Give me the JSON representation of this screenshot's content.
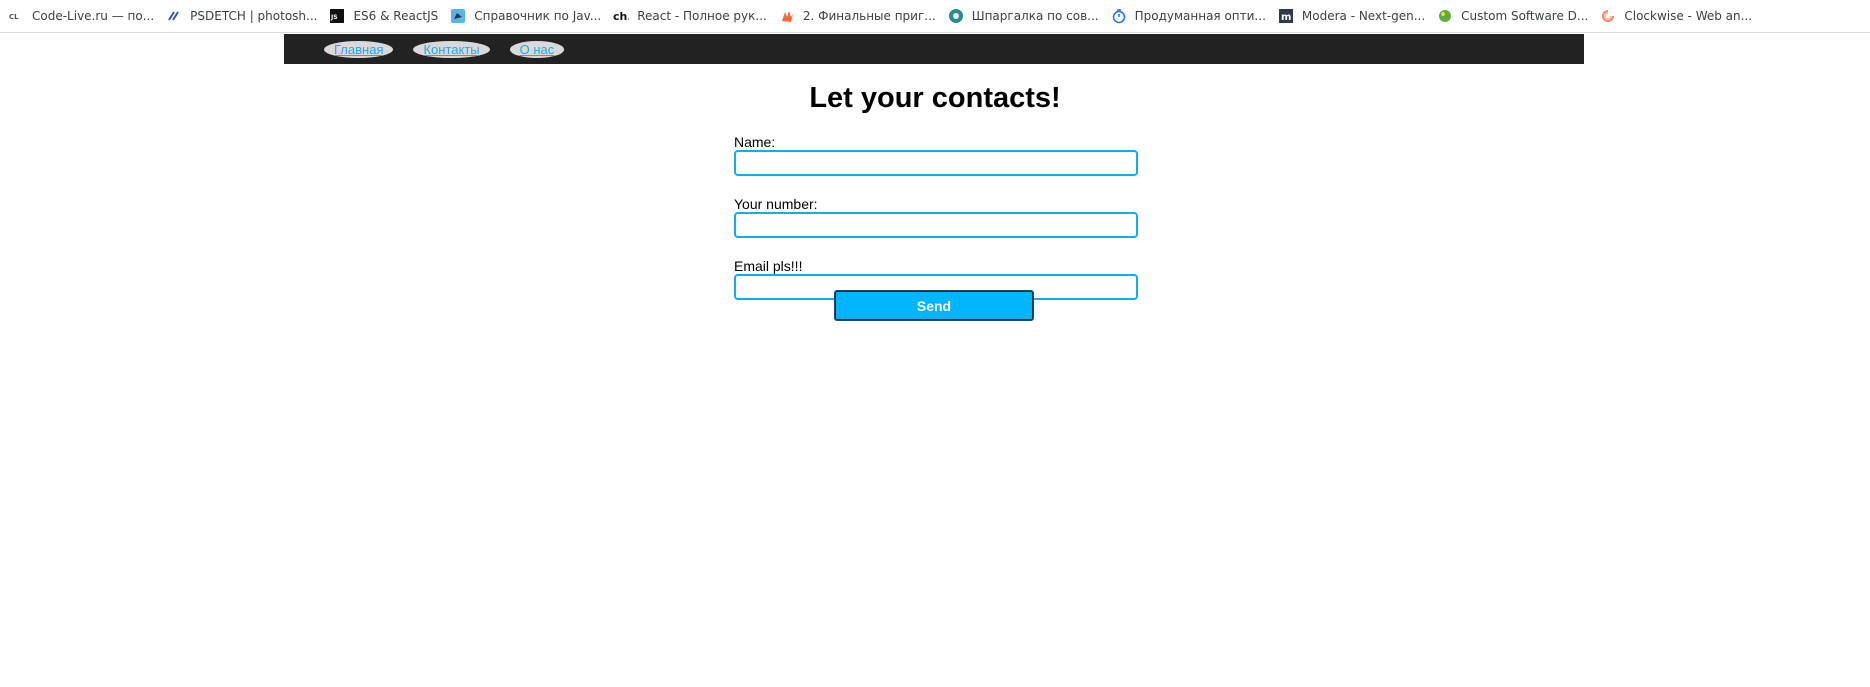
{
  "bookmarks": [
    {
      "icon": "code-live-icon",
      "label": "Code-Live.ru — по..."
    },
    {
      "icon": "psdetch-icon",
      "label": "PSDETCH | photosh..."
    },
    {
      "icon": "es6-react-icon",
      "label": "ES6 & ReactJS"
    },
    {
      "icon": "javascript-reference-icon",
      "label": "Справочник по Jav..."
    },
    {
      "icon": "ch-icon",
      "label": "React - Полное рук..."
    },
    {
      "icon": "hand-icon",
      "label": "2. Финальные приг..."
    },
    {
      "icon": "cheatsheet-icon",
      "label": "Шпаргалка по сов..."
    },
    {
      "icon": "stopwatch-icon",
      "label": "Продуманная опти..."
    },
    {
      "icon": "modera-icon",
      "label": "Modera - Next-gen..."
    },
    {
      "icon": "custom-software-icon",
      "label": "Custom Software D..."
    },
    {
      "icon": "clockwise-icon",
      "label": "Clockwise - Web an..."
    }
  ],
  "nav": {
    "links": [
      "Главная",
      "Контакты",
      "О нас"
    ]
  },
  "page": {
    "title": "Let your contacts!"
  },
  "form": {
    "fields": [
      {
        "label": "Name:",
        "value": "",
        "placeholder": ""
      },
      {
        "label": "Your number:",
        "value": "",
        "placeholder": ""
      },
      {
        "label": "Email pls!!!",
        "value": "",
        "placeholder": ""
      }
    ],
    "submit_label": "Send"
  },
  "colors": {
    "nav_background": "#222222",
    "nav_link_text": "#29a8e0",
    "nav_link_background": "#d9d9d9",
    "input_border": "#11aee4",
    "button_background": "#00b5ff"
  }
}
